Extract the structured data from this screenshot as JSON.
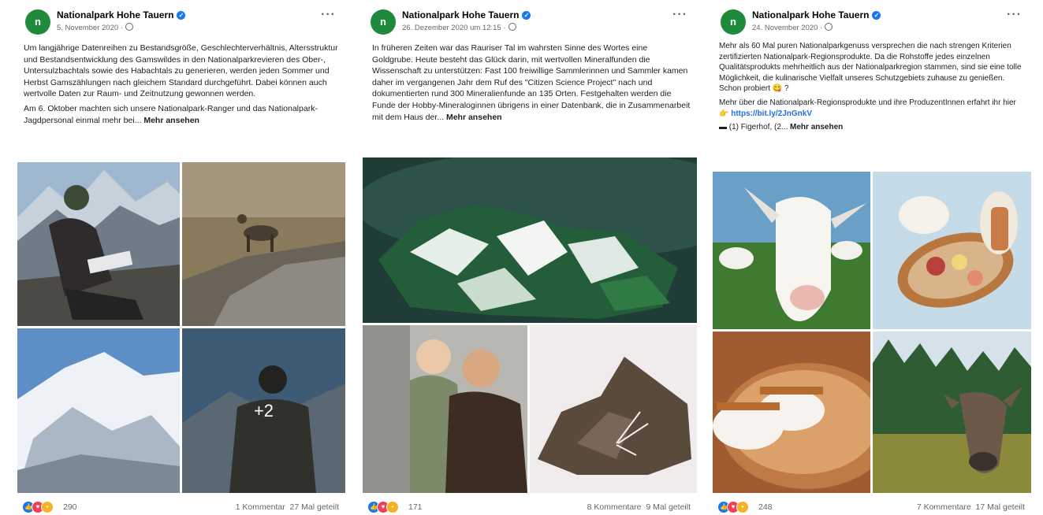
{
  "posts": [
    {
      "page_name": "Nationalpark Hohe Tauern",
      "avatar_letter": "n",
      "date": "5. November 2020 ·",
      "paragraphs": [
        "Um langjährige Datenreihen zu Bestandsgröße, Geschlechterverhältnis, Altersstruktur und Bestandsentwicklung des Gamswildes in den Nationalparkrevieren des Ober-, Untersulzbachtals sowie des Habachtals zu generieren, werden jeden Sommer und Herbst Gamszählungen nach gleichem Standard durchgeführt. Dabei können auch wertvolle Daten zur Raum- und Zeitnutzung gewonnen werden.",
        "Am 6. Oktober machten sich unsere Nationalpark-Ranger und das Nationalpark-Jagdpersonal einmal mehr bei..."
      ],
      "more_label": "Mehr ansehen",
      "photo_overlay": "+2",
      "reaction_count": "290",
      "comments": "1 Kommentar",
      "shares": "27 Mal geteilt"
    },
    {
      "page_name": "Nationalpark Hohe Tauern",
      "avatar_letter": "n",
      "date": "26. Dezember 2020 um 12:15 ·",
      "paragraphs": [
        "In früheren Zeiten war das Rauriser Tal im wahrsten Sinne des Wortes eine Goldgrube. Heute besteht das Glück darin, mit wertvollen Mineralfunden die Wissenschaft zu unterstützen: Fast 100 freiwillige Sammlerinnen und Sammler kamen daher im vergangenen Jahr dem Ruf des \"Citizen Science Project\" nach und dokumentierten rund 300 Mineralienfunde an 135 Orten. Festgehalten werden die Funde der Hobby-Mineraloginnen übrigens in einer Datenbank, die in Zusammenarbeit mit dem Haus der..."
      ],
      "more_label": "Mehr ansehen",
      "reaction_count": "171",
      "comments": "8 Kommentare",
      "shares": "9 Mal geteilt"
    },
    {
      "page_name": "Nationalpark Hohe Tauern",
      "avatar_letter": "n",
      "date": "24. November 2020 ·",
      "paragraphs": [
        "Mehr als 60 Mal puren Nationalparkgenuss versprechen die nach strengen Kriterien zertifizierten Nationalpark-Regionsprodukte. Da die Rohstoffe jedes einzelnen Qualitätsprodukts mehrheitlich aus der Nationalparkregion stammen, sind sie eine tolle Möglichkeit, die kulinarische Vielfalt unseres Schutzgebiets zuhause zu genießen. Schon probiert 😋 ?",
        "Mehr über die Nationalpark-Regionsprodukte und ihre ProduzentInnen erfahrt ihr hier 👉"
      ],
      "link": "https://bit.ly/2JnGnkV",
      "extra_line": "▬ (1) Figerhof, (2...",
      "more_label": "Mehr ansehen",
      "reaction_count": "248",
      "comments": "7 Kommentare",
      "shares": "17 Mal geteilt"
    }
  ],
  "colors": {
    "brand": "#1f8a3c",
    "link": "#216fdb",
    "like": "#1877f2",
    "love": "#f33e58",
    "wow": "#f7b125"
  },
  "icons": {
    "verified": "verified-badge-icon",
    "audience": "globe-icon",
    "options": "more-options-icon"
  }
}
